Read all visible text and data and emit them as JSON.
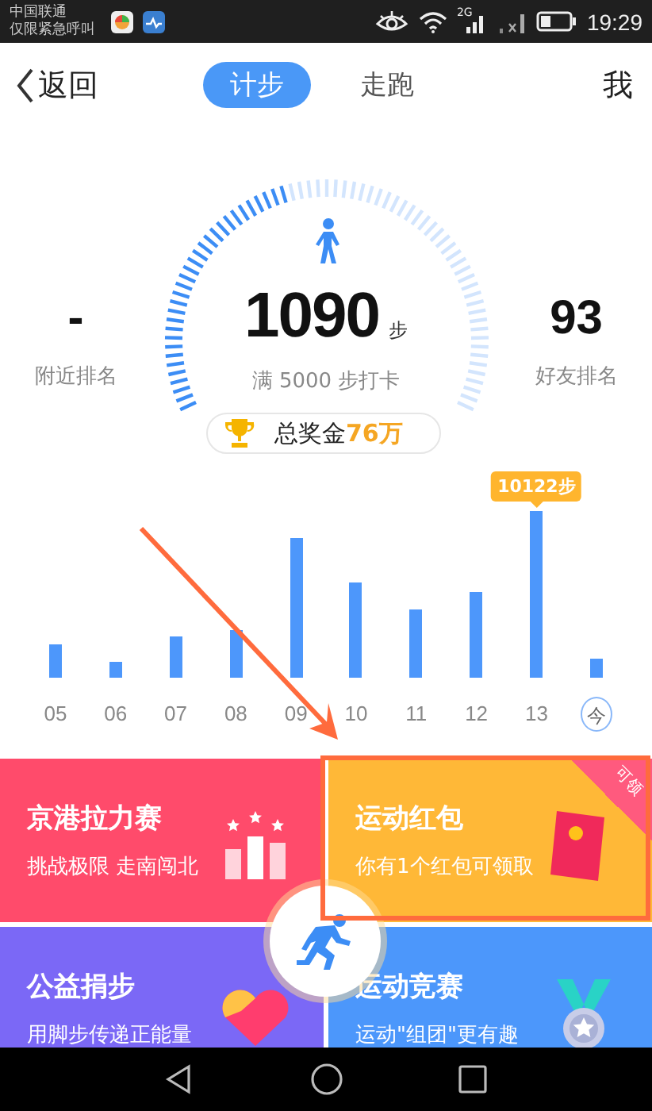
{
  "status_bar": {
    "carrier": "中国联通",
    "carrier_note": "仅限紧急呼叫",
    "network": "2G",
    "time": "19:29"
  },
  "header": {
    "back": "返回",
    "tabs": [
      {
        "label": "计步",
        "selected": true
      },
      {
        "label": "走跑",
        "selected": false
      }
    ],
    "me": "我"
  },
  "summary": {
    "nearby_rank": "-",
    "nearby_label": "附近排名",
    "steps": "1090",
    "steps_unit": "步",
    "goal": "满 5000 步打卡",
    "friend_rank": "93",
    "friend_label": "好友排名",
    "prize": {
      "label": "总奖金",
      "amount": "76万"
    }
  },
  "history": {
    "days": [
      {
        "label": "05",
        "today": false
      },
      {
        "label": "06",
        "today": false
      },
      {
        "label": "07",
        "today": false
      },
      {
        "label": "08",
        "today": false
      },
      {
        "label": "09",
        "today": false
      },
      {
        "label": "10",
        "today": false
      },
      {
        "label": "11",
        "today": false
      },
      {
        "label": "12",
        "today": false
      },
      {
        "label": "13",
        "today": false,
        "tooltip": "10122步"
      },
      {
        "label": "今",
        "today": true
      }
    ]
  },
  "cards": [
    {
      "title": "京港拉力赛",
      "subtitle": "挑战极限 走南闯北",
      "color": "#ff4b6b",
      "kind": "podium"
    },
    {
      "title": "运动红包",
      "subtitle": "你有1个红包可领取",
      "color": "#ffb837",
      "kind": "envelope",
      "ribbon": "可领"
    },
    {
      "title": "公益捐步",
      "subtitle": "用脚步传递正能量",
      "color": "#7b68f6",
      "kind": "heart"
    },
    {
      "title": "运动竞赛",
      "subtitle": "运动\"组团\"更有趣",
      "color": "#4c97fb",
      "kind": "medal"
    }
  ]
}
